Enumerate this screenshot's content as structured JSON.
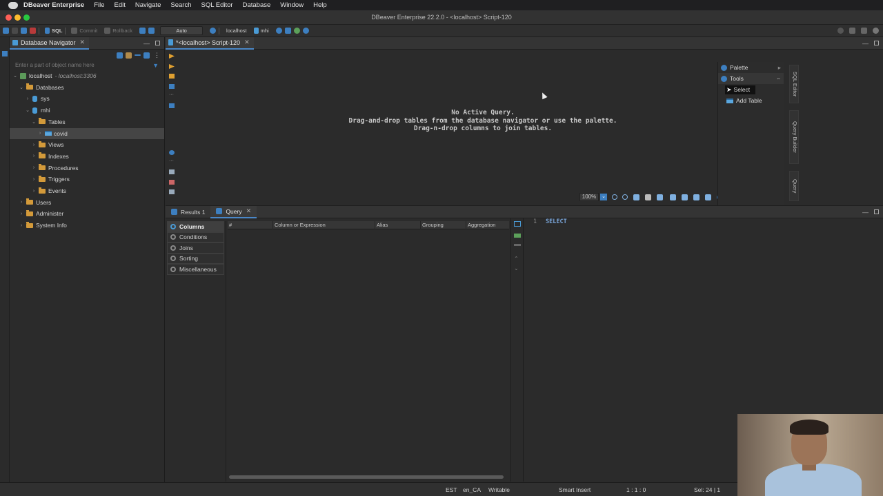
{
  "menubar": {
    "app_name": "DBeaver Enterprise",
    "items": [
      "File",
      "Edit",
      "Navigate",
      "Search",
      "SQL Editor",
      "Database",
      "Window",
      "Help"
    ]
  },
  "window": {
    "title": "DBeaver Enterprise 22.2.0 - <localhost> Script-120"
  },
  "toolbar": {
    "sql_label": "SQL",
    "commit_label": "Commit",
    "rollback_label": "Rollback",
    "tx_mode": "Auto",
    "connection": "localhost",
    "schema": "mhi"
  },
  "navigator": {
    "title": "Database Navigator",
    "filter_placeholder": "Enter a part of object name here",
    "tree": [
      {
        "label": "localhost",
        "detail": "- localhost:3306"
      },
      {
        "label": "Databases"
      },
      {
        "label": "sys"
      },
      {
        "label": "mhi"
      },
      {
        "label": "Tables"
      },
      {
        "label": "covid"
      },
      {
        "label": "Views"
      },
      {
        "label": "Indexes"
      },
      {
        "label": "Procedures"
      },
      {
        "label": "Triggers"
      },
      {
        "label": "Events"
      },
      {
        "label": "Users"
      },
      {
        "label": "Administer"
      },
      {
        "label": "System Info"
      }
    ]
  },
  "editor": {
    "tab_label": "*<localhost> Script-120",
    "empty_line1": "No Active Query.",
    "empty_line2": "Drag-and-drop tables from the database navigator or use the palette.",
    "empty_line3": "Drag-n-drop columns to join tables.",
    "zoom": "100%"
  },
  "palette": {
    "title": "Palette",
    "tools_label": "Tools",
    "select_label": "Select",
    "add_table_label": "Add Table"
  },
  "side_tabs": {
    "sql_editor": "SQL Editor",
    "query_builder": "Query Builder",
    "query": "Query"
  },
  "bottom": {
    "tabs": [
      "Results 1",
      "Query"
    ],
    "sections": [
      "Columns",
      "Conditions",
      "Joins",
      "Sorting",
      "Miscellaneous"
    ],
    "grid_headers": [
      "#",
      "Column or Expression",
      "Alias",
      "Grouping",
      "Aggregation"
    ],
    "sql_line_number": "1",
    "sql_text": "SELECT"
  },
  "status": {
    "timezone": "EST",
    "locale": "en_CA",
    "mode": "Writable",
    "insert": "Smart Insert",
    "position": "1 : 1 : 0",
    "selection": "Sel: 24 | 1"
  },
  "colors": {
    "accent": "#4a87c8",
    "folder": "#d39a3a",
    "keyword": "#7aa6da"
  }
}
